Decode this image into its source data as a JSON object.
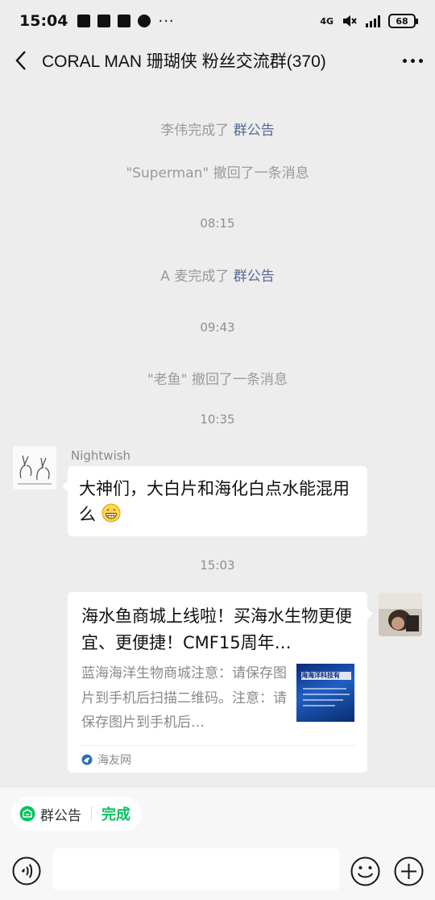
{
  "status_bar": {
    "time": "15:04",
    "network": "4G",
    "battery": "68"
  },
  "header": {
    "title": "CORAL MAN 珊瑚侠 粉丝交流群(370)"
  },
  "chat": {
    "system_1_prefix": "李伟完成了 ",
    "system_1_link": "群公告",
    "system_2": "\"Superman\" 撤回了一条消息",
    "time_1": "08:15",
    "system_3_prefix": "A 麦完成了 ",
    "system_3_link": "群公告",
    "time_2": "09:43",
    "system_4": "\"老鱼\" 撤回了一条消息",
    "time_3": "10:35",
    "message_1": {
      "sender": "Nightwish",
      "text": "大神们，大白片和海化白点水能混用么"
    },
    "time_4": "15:03",
    "link_card": {
      "title": "海水鱼商城上线啦！买海水生物更便宜、更便捷！CMF15周年…",
      "description": "蓝海海洋生物商城注意：请保存图片到手机后扫描二维码。注意：请保存图片到手机后…",
      "thumb_text": "海海洋科技有",
      "source": "海友网"
    }
  },
  "bottom_bar": {
    "pinned_label": "群公告",
    "pinned_status": "完成"
  },
  "colors": {
    "background": "#ededed",
    "link": "#576b95",
    "accent_green": "#07c160"
  },
  "icons": [
    "back-arrow-icon",
    "more-icon",
    "voice-icon",
    "emoji-icon",
    "plus-icon",
    "announcement-icon",
    "grin-emoji"
  ]
}
